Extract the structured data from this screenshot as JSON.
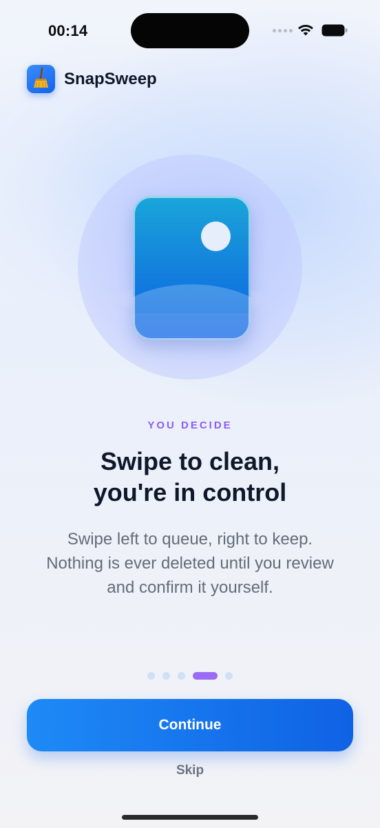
{
  "status_bar": {
    "time": "00:14"
  },
  "header": {
    "app_name": "SnapSweep",
    "logo_icon": "broom-icon"
  },
  "hero": {
    "icon": "photo-icon"
  },
  "onboarding": {
    "eyebrow": "YOU DECIDE",
    "headline_lines": [
      "Swipe to clean,",
      "you're in control"
    ],
    "body_lines": [
      "Swipe left to queue, right to keep.",
      "Nothing is ever deleted until you review",
      "and confirm it yourself."
    ]
  },
  "pager": {
    "total": 5,
    "current": 4
  },
  "actions": {
    "continue_label": "Continue",
    "skip_label": "Skip"
  },
  "colors": {
    "accent": "#1463EA",
    "eyebrow": "#8B5CF6",
    "active_dot": "#9B6CF3"
  }
}
